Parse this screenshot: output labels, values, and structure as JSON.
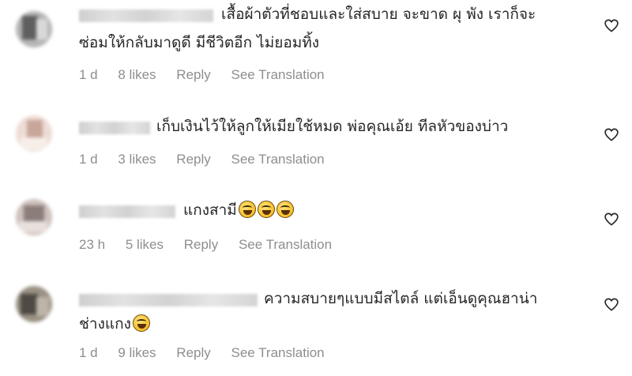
{
  "comments": [
    {
      "text_lines": [
        "เสื้อผ้าตัวที่ชอบและใส่สบาย จะขาด ผุ พัง เราก็จะ",
        "ซ่อมให้กลับมาดูดี มีชีวิตอีก ไม่ยอมทิ้ง"
      ],
      "emojis": 0,
      "time": "1 d",
      "likes": "8 likes",
      "reply": "Reply",
      "see_translation": "See Translation",
      "avatar_colors": [
        "#9a9a9a",
        "#5f5f5f",
        "#c9c9c9"
      ],
      "like_icon": "heart-outline-icon"
    },
    {
      "text_lines": [
        "เก็บเงินไว้ให้ลูกให้เมียใช้หมด พ่อคุณเอ้ย ทีลหัวของบ่าว"
      ],
      "emojis": 0,
      "time": "1 d",
      "likes": "3 likes",
      "reply": "Reply",
      "see_translation": "See Translation",
      "avatar_colors": [
        "#e8cfc4",
        "#c9a69a",
        "#f3e6e0"
      ],
      "like_icon": "heart-outline-icon"
    },
    {
      "text_lines": [
        "แกงสามี"
      ],
      "emojis": 3,
      "time": "23 h",
      "likes": "5 likes",
      "reply": "Reply",
      "see_translation": "See Translation",
      "avatar_colors": [
        "#b8a29a",
        "#8b7d7a",
        "#ddd3cf"
      ],
      "like_icon": "heart-outline-icon"
    },
    {
      "text_lines": [
        "ความสบายๆแบบมีสไตล์ แต่เอ็นดูคุณฮาน่า",
        "ช่างแกง"
      ],
      "emojis": 1,
      "time": "1 d",
      "likes": "9 likes",
      "reply": "Reply",
      "see_translation": "See Translation",
      "avatar_colors": [
        "#7c7468",
        "#a69e8f",
        "#4f4a43"
      ],
      "like_icon": "heart-outline-icon"
    }
  ]
}
